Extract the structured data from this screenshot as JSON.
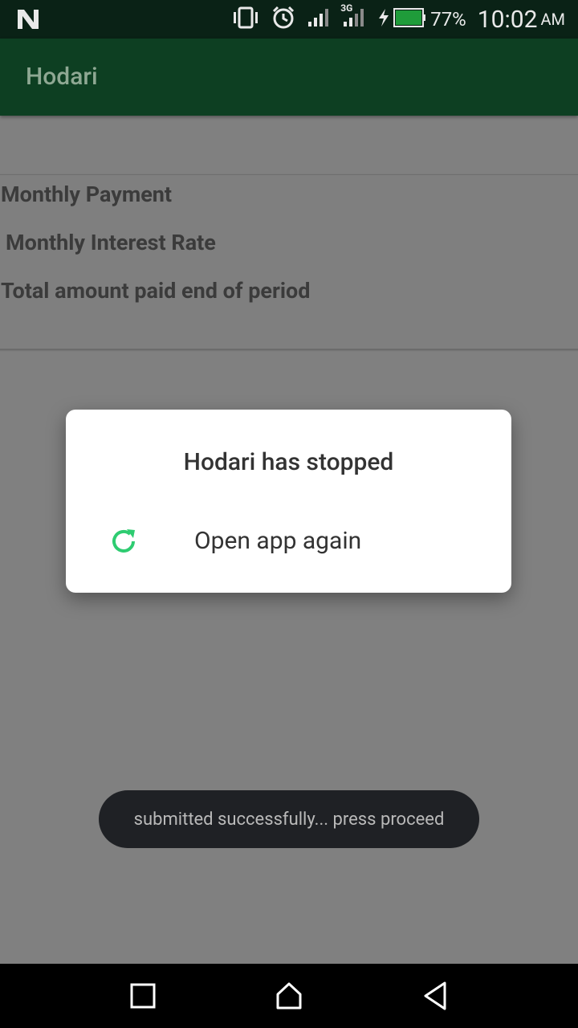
{
  "status_bar": {
    "battery_percent": "77%",
    "time": "10:02",
    "ampm": "AM",
    "network_type": "3G",
    "icons": [
      "notification-n-icon",
      "vibrate-icon",
      "alarm-icon",
      "signal-icon",
      "signal-3g-icon",
      "charging-icon",
      "battery-icon"
    ]
  },
  "app_bar": {
    "title": "Hodari"
  },
  "card": {
    "rows": [
      {
        "label": "Monthly Payment"
      },
      {
        "label": " Monthly Interest Rate"
      },
      {
        "label": "Total amount paid end of period"
      }
    ]
  },
  "dialog": {
    "title": "Hodari has stopped",
    "action_label": "Open app again",
    "action_icon": "refresh-icon",
    "accent_color": "#2ecc71"
  },
  "toast": {
    "message": "submitted successfully... press proceed"
  },
  "nav_bar": {
    "buttons": [
      "recent-apps-icon",
      "home-icon",
      "back-icon"
    ]
  }
}
